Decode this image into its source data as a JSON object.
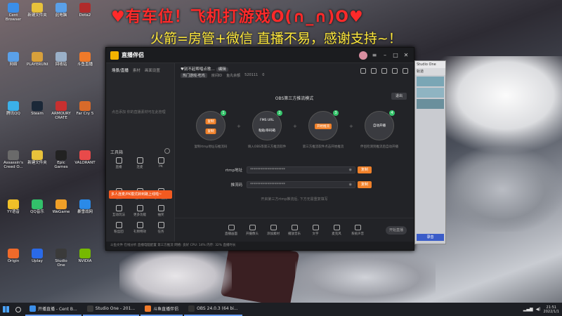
{
  "overlay": {
    "line1": "♥有车位！飞机打游戏O(∩_∩)O♥",
    "line2": "火箭=房管+微信 直播不易，感谢支持~！"
  },
  "desktop_icons": [
    {
      "label": "Cent Browser",
      "color": "#3b8ee8"
    },
    {
      "label": "新建文件夹",
      "color": "#e8c23b"
    },
    {
      "label": "此电脑",
      "color": "#5aa0e8"
    },
    {
      "label": "Dota2",
      "color": "#b02b2b"
    },
    {
      "label": "网络",
      "color": "#5aa0e8"
    },
    {
      "label": "PLAYERUNKNOWN'S",
      "color": "#d8a03b"
    },
    {
      "label": "回收站",
      "color": "#9ab0c8"
    },
    {
      "label": "斗鱼直播",
      "color": "#f07a2a"
    },
    {
      "label": "腾讯QQ",
      "color": "#3bb0e8"
    },
    {
      "label": "Steam",
      "color": "#1b2838"
    },
    {
      "label": "ARMOURY CRATE",
      "color": "#c83030"
    },
    {
      "label": "Far Cry 5",
      "color": "#d86a2a"
    },
    {
      "label": "Assassin's Creed O...",
      "color": "#6a6a6a"
    },
    {
      "label": "新建文件夹",
      "color": "#e8c23b"
    },
    {
      "label": "Epic Games",
      "color": "#222"
    },
    {
      "label": "VALORANT",
      "color": "#e84a4a"
    },
    {
      "label": "YY语音",
      "color": "#f0c028"
    },
    {
      "label": "QQ音乐",
      "color": "#32c06a"
    },
    {
      "label": "WeGame",
      "color": "#f0a028"
    },
    {
      "label": "暴雪战网",
      "color": "#2a8ae8"
    },
    {
      "label": "Origin",
      "color": "#f06a2a"
    },
    {
      "label": "Uplay",
      "color": "#2a6ae8"
    },
    {
      "label": "Studio One",
      "color": "#3a3a3a"
    },
    {
      "label": "NVIDIA",
      "color": "#76b900"
    }
  ],
  "app": {
    "title": "直播伴侣",
    "sidebar": {
      "tabs": [
        "场景/直播",
        "素材",
        "画面设置"
      ],
      "scene_hint": "点击添加 你的直播素材可在此管理",
      "tools_title": "工具箱",
      "tools": [
        "直播",
        "连麦",
        "PK",
        "福袋",
        "送礼物",
        "多人连麦",
        "互动玩法",
        "更多功能",
        "抽奖",
        "粉丝团",
        "礼物特效",
        "任务"
      ],
      "promo": "多人连麦/PK模式转到路上线啦~"
    },
    "room": {
      "title": "♥别不起帮唱点歌…",
      "edit_label": "编辑",
      "meta": [
        "热门游戏-吃鸡",
        "房间ID",
        "鱼丸余额",
        "520111",
        "0"
      ]
    },
    "obs": {
      "title": "OBS第三方推流模式",
      "quit_label": "退出",
      "steps": [
        {
          "num": "1",
          "inner": [
            "复制",
            "复制"
          ],
          "caption": "复制rtmp地址与推流码"
        },
        {
          "num": "2",
          "inner": [
            "FMS URL",
            "粘贴/串码箱"
          ],
          "caption": "填入OBS等第三方推流软件"
        },
        {
          "num": "3",
          "inner": [
            "开始推流"
          ],
          "caption": "第三方推流软件点击开始推流"
        },
        {
          "num": "4",
          "inner": [
            "自动开播"
          ],
          "caption": "伴侣检测到推流后自动开播"
        }
      ],
      "rtmp_label": "rtmp地址",
      "rtmp_value": "********************",
      "key_label": "推流码",
      "key_value": "********************",
      "copy_label": "复制",
      "hint": "开启第三方rtmp推流后, 下方无需重复填写"
    },
    "bottom_tools": [
      "直播画面",
      "开摄像头",
      "添加素材",
      "播放音乐",
      "文字",
      "麦克风",
      "系统声音"
    ],
    "live_button": "开始直播",
    "status": "斗鱼文件  在线分析  直播电脑配置  第三方推流  网络: 良好  CPU: 14%  内存: 32%  直播时长"
  },
  "daw": {
    "title": "Studio One",
    "tab": "轨道",
    "blue_label": "录音"
  },
  "taskbar": {
    "tasks": [
      {
        "label": "开播直播 - Cent B...",
        "color": "#3b8ee8"
      },
      {
        "label": "Studio One - 201...",
        "color": "#3a3a3a"
      },
      {
        "label": "斗鱼直播伴侣",
        "color": "#f07a2a"
      },
      {
        "label": "OBS 24.0.3 (64 bi...",
        "color": "#333"
      }
    ],
    "time": "21:51",
    "date": "2022/1/1"
  }
}
